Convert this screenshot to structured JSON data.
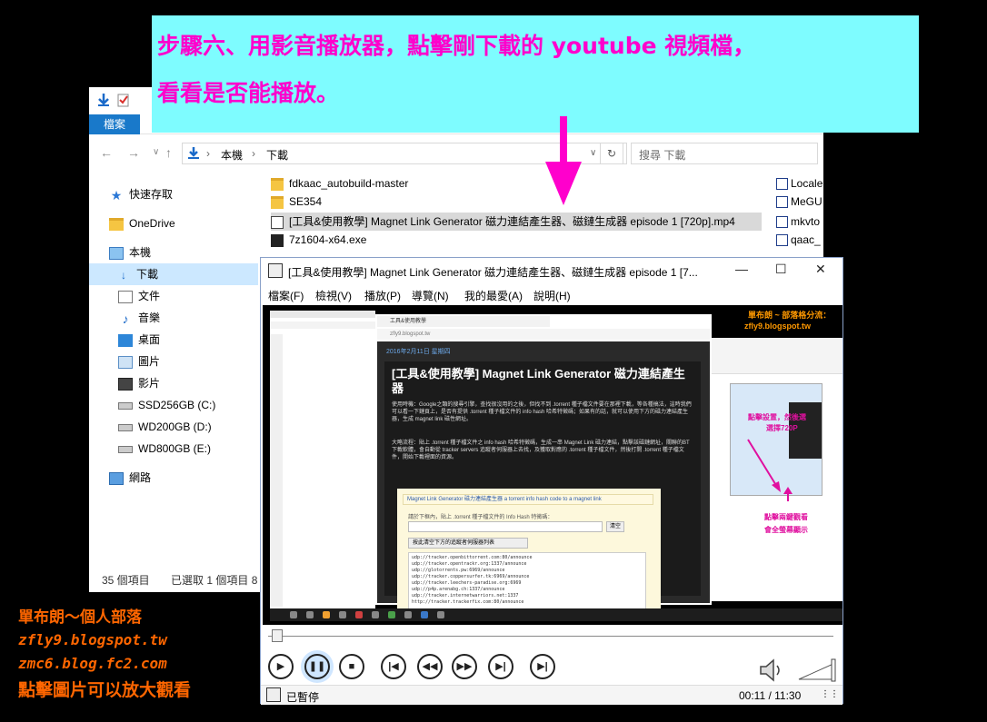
{
  "banner": {
    "line1": "步驟六、用影音播放器，點擊剛下載的 youtube 視頻檔，",
    "line2": "看看是否能播放。",
    "bg_color": "#7efcff",
    "text_color": "#ff00cc"
  },
  "explorer": {
    "ribbon_tab_file": "檔案",
    "breadcrumb": [
      "本機",
      "下載"
    ],
    "search_placeholder": "搜尋 下載",
    "sidebar": [
      {
        "label": "快速存取",
        "icon": "star-icon"
      },
      {
        "label": "OneDrive",
        "icon": "folder-icon"
      },
      {
        "label": "本機",
        "icon": "computer-icon"
      },
      {
        "label": "下載",
        "icon": "download-icon",
        "selected": true
      },
      {
        "label": "文件",
        "icon": "document-icon"
      },
      {
        "label": "音樂",
        "icon": "music-icon"
      },
      {
        "label": "桌面",
        "icon": "desktop-icon"
      },
      {
        "label": "圖片",
        "icon": "picture-icon"
      },
      {
        "label": "影片",
        "icon": "video-icon"
      },
      {
        "label": "SSD256GB (C:)",
        "icon": "drive-icon"
      },
      {
        "label": "WD200GB (D:)",
        "icon": "drive-icon"
      },
      {
        "label": "WD800GB (E:)",
        "icon": "drive-icon"
      },
      {
        "label": "網路",
        "icon": "network-icon"
      }
    ],
    "files": [
      {
        "name": "fdkaac_autobuild-master",
        "icon": "folder-icon"
      },
      {
        "name": "SE354",
        "icon": "folder-icon"
      },
      {
        "name": "[工具&使用教學] Magnet Link Generator 磁力連結產生器、磁鏈生成器 episode 1 [720p].mp4",
        "icon": "video-file-icon",
        "selected": true
      },
      {
        "name": "7z1604-x64.exe",
        "icon": "exe-icon"
      }
    ],
    "right_column": [
      "Locale",
      "MeGU",
      "mkvto",
      "qaac_"
    ],
    "status_items": "35 個項目",
    "status_selected": "已選取 1 個項目  8"
  },
  "player": {
    "title": "[工具&使用教學] Magnet Link Generator 磁力連結產生器、磁鏈生成器 episode 1 [7...",
    "menu": [
      "檔案(F)",
      "檢視(V)",
      "播放(P)",
      "導覽(N)",
      "我的最愛(A)",
      "說明(H)"
    ],
    "status": "已暫停",
    "time": "00:11 / 11:30",
    "video": {
      "page_date": "2016年2月11日 星期四",
      "article_title": "[工具&使用教學] Magnet Link Generator 磁力連結產生器",
      "para1": "使用時機：Google之類的搜尋引擎，查找很沒用的之後，但找不到 .torrent 種子檔文件要在那裡下載，等各種搞法，這時我們可以看一下鏈頁上，是否有提供 .torrent 種子檔文件的 info hash 哈希特徵碼；如果有的話，就可以使用下方的磁力連結產生器，生成 magnet link 磁性網址。",
      "para2": "大略流程：貼上 .torrent 種子檔文件之 info hash 哈希特徵碼，生成一串 Magnet Link 磁力連結，點擊該磁鏈網址，關聯的BT下載軟體，會自動從 tracker servers 追蹤者伺服器上去找，及獲取對應的 .torrent 種子檔文件，然後打開 .torrent 種子檔文件，開始下載裡面的資源。",
      "box_title": "Magnet Link Generator 磁力連結產生器 a torrent info hash code to a magnet link",
      "box_prompt": "請於下框內，貼上 .torrent 種子檔文件的 Info Hash 特徵碼：",
      "clear_button": "清空",
      "trackers_button": "按此清空下方的追蹤者伺服器列表",
      "trackers": "udp://tracker.openbittorrent.com:80/announce\nudp://tracker.opentrackr.org:1337/announce\nudp://glotorrents.pw:6969/announce\nudp://tracker.coppersurfer.tk:6969/announce\nudp://tracker.leechers-paradise.org:6969\nudp://p4p.arenabg.ch:1337/announce\nudp://tracker.internetwarriors.net:1337\nhttp://tracker.trackerfix.com:80/announce",
      "credit_line1": "單布朗 ~ 部落格分流：",
      "credit_line2": "zfly9.blogspot.tw",
      "annotation1": "點擊設置，然後選",
      "annotation2": "選擇720P",
      "annotation3": "點擊兩鍵觀看",
      "annotation4": "會全螢幕顯示"
    }
  },
  "credits": {
    "line1": "單布朗～個人部落",
    "line2": "zfly9.blogspot.tw",
    "line3": "zmc6.blog.fc2.com",
    "line4": "點擊圖片可以放大觀看",
    "color": "#ff6600"
  }
}
